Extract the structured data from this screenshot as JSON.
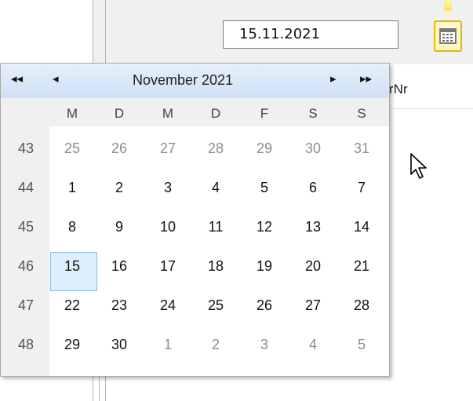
{
  "date_field": {
    "value": "15.11.2021"
  },
  "grid": {
    "column_partial_label": "rNr"
  },
  "calendar": {
    "nav": {
      "prev_year": "◂◂",
      "prev_month": "◂",
      "next_month": "▸",
      "next_year": "▸▸"
    },
    "month_title": "November 2021",
    "weekday_headers": [
      "M",
      "D",
      "M",
      "D",
      "F",
      "S",
      "S"
    ],
    "week_numbers": [
      "43",
      "44",
      "45",
      "46",
      "47",
      "48"
    ],
    "weeks": [
      [
        "25",
        "26",
        "27",
        "28",
        "29",
        "30",
        "31"
      ],
      [
        "1",
        "2",
        "3",
        "4",
        "5",
        "6",
        "7"
      ],
      [
        "8",
        "9",
        "10",
        "11",
        "12",
        "13",
        "14"
      ],
      [
        "15",
        "16",
        "17",
        "18",
        "19",
        "20",
        "21"
      ],
      [
        "22",
        "23",
        "24",
        "25",
        "26",
        "27",
        "28"
      ],
      [
        "29",
        "30",
        "1",
        "2",
        "3",
        "4",
        "5"
      ]
    ],
    "selected_day": "15"
  },
  "colors": {
    "header_gradient_top": "#e6f0fb",
    "header_gradient_bottom": "#cfe0f5",
    "selection_fill": "#ddeeff",
    "selection_border": "#8cb8e8",
    "button_highlight": "#e6b800"
  },
  "icons": [
    "calendar-icon",
    "mouse-cursor-icon"
  ]
}
